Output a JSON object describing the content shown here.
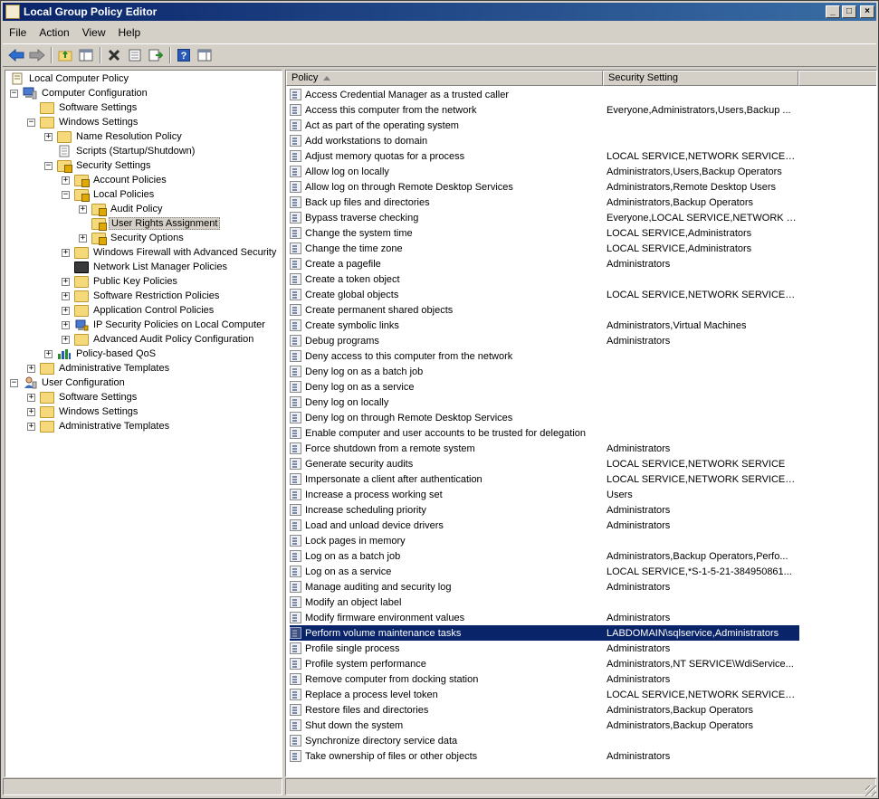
{
  "window": {
    "title": "Local Group Policy Editor",
    "controls": [
      "_",
      "□",
      "×"
    ]
  },
  "menu": [
    "File",
    "Action",
    "View",
    "Help"
  ],
  "toolbar": [
    "back-arrow-icon",
    "forward-arrow-icon",
    "up-folder-icon",
    "show-hide-tree-icon",
    "delete-icon",
    "properties-icon",
    "export-list-icon",
    "help-icon",
    "show-action-pane-icon"
  ],
  "tree": [
    {
      "label": "Local Computer Policy",
      "depth": 0,
      "expander": "",
      "icon": "computer-policy-icon"
    },
    {
      "label": "Computer Configuration",
      "depth": 0,
      "expander": "−",
      "icon": "computer-icon"
    },
    {
      "label": "Software Settings",
      "depth": 1,
      "expander": "",
      "icon": "folder-icon"
    },
    {
      "label": "Windows Settings",
      "depth": 1,
      "expander": "−",
      "icon": "folder-icon"
    },
    {
      "label": "Name Resolution Policy",
      "depth": 2,
      "expander": "+",
      "icon": "folder-icon"
    },
    {
      "label": "Scripts (Startup/Shutdown)",
      "depth": 2,
      "expander": "",
      "icon": "script-icon"
    },
    {
      "label": "Security Settings",
      "depth": 2,
      "expander": "−",
      "icon": "folder-lock-icon"
    },
    {
      "label": "Account Policies",
      "depth": 3,
      "expander": "+",
      "icon": "folder-lock-icon"
    },
    {
      "label": "Local Policies",
      "depth": 3,
      "expander": "−",
      "icon": "folder-lock-icon"
    },
    {
      "label": "Audit Policy",
      "depth": 4,
      "expander": "+",
      "icon": "folder-lock-icon"
    },
    {
      "label": "User Rights Assignment",
      "depth": 4,
      "expander": "",
      "icon": "folder-lock-icon",
      "selected": true
    },
    {
      "label": "Security Options",
      "depth": 4,
      "expander": "+",
      "icon": "folder-lock-icon"
    },
    {
      "label": "Windows Firewall with Advanced Security",
      "depth": 3,
      "expander": "+",
      "icon": "folder-icon"
    },
    {
      "label": "Network List Manager Policies",
      "depth": 3,
      "expander": "",
      "icon": "network-list-icon"
    },
    {
      "label": "Public Key Policies",
      "depth": 3,
      "expander": "+",
      "icon": "folder-icon"
    },
    {
      "label": "Software Restriction Policies",
      "depth": 3,
      "expander": "+",
      "icon": "folder-icon"
    },
    {
      "label": "Application Control Policies",
      "depth": 3,
      "expander": "+",
      "icon": "folder-icon"
    },
    {
      "label": "IP Security Policies on Local Computer",
      "depth": 3,
      "expander": "+",
      "icon": "ip-security-icon"
    },
    {
      "label": "Advanced Audit Policy Configuration",
      "depth": 3,
      "expander": "+",
      "icon": "folder-icon"
    },
    {
      "label": "Policy-based QoS",
      "depth": 2,
      "expander": "+",
      "icon": "qos-chart-icon"
    },
    {
      "label": "Administrative Templates",
      "depth": 1,
      "expander": "+",
      "icon": "folder-icon"
    },
    {
      "label": "User Configuration",
      "depth": 0,
      "expander": "−",
      "icon": "user-icon"
    },
    {
      "label": "Software Settings",
      "depth": 1,
      "expander": "+",
      "icon": "folder-icon"
    },
    {
      "label": "Windows Settings",
      "depth": 1,
      "expander": "+",
      "icon": "folder-icon"
    },
    {
      "label": "Administrative Templates",
      "depth": 1,
      "expander": "+",
      "icon": "folder-icon"
    }
  ],
  "list": {
    "columns": [
      "Policy",
      "Security Setting"
    ],
    "rows": [
      {
        "policy": "Access Credential Manager as a trusted caller",
        "setting": ""
      },
      {
        "policy": "Access this computer from the network",
        "setting": "Everyone,Administrators,Users,Backup ..."
      },
      {
        "policy": "Act as part of the operating system",
        "setting": ""
      },
      {
        "policy": "Add workstations to domain",
        "setting": ""
      },
      {
        "policy": "Adjust memory quotas for a process",
        "setting": "LOCAL SERVICE,NETWORK SERVICE,*S..."
      },
      {
        "policy": "Allow log on locally",
        "setting": "Administrators,Users,Backup Operators"
      },
      {
        "policy": "Allow log on through Remote Desktop Services",
        "setting": "Administrators,Remote Desktop Users"
      },
      {
        "policy": "Back up files and directories",
        "setting": "Administrators,Backup Operators"
      },
      {
        "policy": "Bypass traverse checking",
        "setting": "Everyone,LOCAL SERVICE,NETWORK S..."
      },
      {
        "policy": "Change the system time",
        "setting": "LOCAL SERVICE,Administrators"
      },
      {
        "policy": "Change the time zone",
        "setting": "LOCAL SERVICE,Administrators"
      },
      {
        "policy": "Create a pagefile",
        "setting": "Administrators"
      },
      {
        "policy": "Create a token object",
        "setting": ""
      },
      {
        "policy": "Create global objects",
        "setting": "LOCAL SERVICE,NETWORK SERVICE,A..."
      },
      {
        "policy": "Create permanent shared objects",
        "setting": ""
      },
      {
        "policy": "Create symbolic links",
        "setting": "Administrators,Virtual Machines"
      },
      {
        "policy": "Debug programs",
        "setting": "Administrators"
      },
      {
        "policy": "Deny access to this computer from the network",
        "setting": ""
      },
      {
        "policy": "Deny log on as a batch job",
        "setting": ""
      },
      {
        "policy": "Deny log on as a service",
        "setting": ""
      },
      {
        "policy": "Deny log on locally",
        "setting": ""
      },
      {
        "policy": "Deny log on through Remote Desktop Services",
        "setting": ""
      },
      {
        "policy": "Enable computer and user accounts to be trusted for delegation",
        "setting": ""
      },
      {
        "policy": "Force shutdown from a remote system",
        "setting": "Administrators"
      },
      {
        "policy": "Generate security audits",
        "setting": "LOCAL SERVICE,NETWORK SERVICE"
      },
      {
        "policy": "Impersonate a client after authentication",
        "setting": "LOCAL SERVICE,NETWORK SERVICE,A..."
      },
      {
        "policy": "Increase a process working set",
        "setting": "Users"
      },
      {
        "policy": "Increase scheduling priority",
        "setting": "Administrators"
      },
      {
        "policy": "Load and unload device drivers",
        "setting": "Administrators"
      },
      {
        "policy": "Lock pages in memory",
        "setting": ""
      },
      {
        "policy": "Log on as a batch job",
        "setting": "Administrators,Backup Operators,Perfo..."
      },
      {
        "policy": "Log on as a service",
        "setting": "LOCAL SERVICE,*S-1-5-21-384950861..."
      },
      {
        "policy": "Manage auditing and security log",
        "setting": "Administrators"
      },
      {
        "policy": "Modify an object label",
        "setting": ""
      },
      {
        "policy": "Modify firmware environment values",
        "setting": "Administrators"
      },
      {
        "policy": "Perform volume maintenance tasks",
        "setting": "LABDOMAIN\\sqlservice,Administrators",
        "selected": true
      },
      {
        "policy": "Profile single process",
        "setting": "Administrators"
      },
      {
        "policy": "Profile system performance",
        "setting": "Administrators,NT SERVICE\\WdiService..."
      },
      {
        "policy": "Remove computer from docking station",
        "setting": "Administrators"
      },
      {
        "policy": "Replace a process level token",
        "setting": "LOCAL SERVICE,NETWORK SERVICE,*S..."
      },
      {
        "policy": "Restore files and directories",
        "setting": "Administrators,Backup Operators"
      },
      {
        "policy": "Shut down the system",
        "setting": "Administrators,Backup Operators"
      },
      {
        "policy": "Synchronize directory service data",
        "setting": ""
      },
      {
        "policy": "Take ownership of files or other objects",
        "setting": "Administrators"
      }
    ]
  }
}
